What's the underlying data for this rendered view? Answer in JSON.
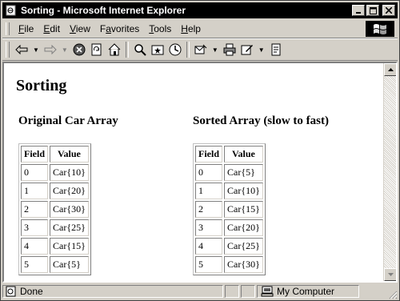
{
  "window": {
    "title": "Sorting - Microsoft Internet Explorer"
  },
  "menu": {
    "items": [
      {
        "key": "F",
        "rest": "ile"
      },
      {
        "key": "E",
        "rest": "dit"
      },
      {
        "key": "V",
        "rest": "iew"
      },
      {
        "key": "",
        "pre": "F",
        "key2": "a",
        "rest": "vorites"
      },
      {
        "key": "T",
        "rest": "ools"
      },
      {
        "key": "H",
        "rest": "elp"
      }
    ]
  },
  "toolbar": {
    "icons": [
      "back-icon",
      "forward-icon",
      "stop-icon",
      "refresh-icon",
      "home-icon",
      "search-icon",
      "favorites-icon",
      "history-icon",
      "mail-icon",
      "print-icon",
      "edit-icon",
      "discuss-icon"
    ]
  },
  "page": {
    "title": "Sorting",
    "original": {
      "heading": "Original Car Array",
      "col_field": "Field",
      "col_value": "Value",
      "rows": [
        {
          "field": "0",
          "value": "Car{10}"
        },
        {
          "field": "1",
          "value": "Car{20}"
        },
        {
          "field": "2",
          "value": "Car{30}"
        },
        {
          "field": "3",
          "value": "Car{25}"
        },
        {
          "field": "4",
          "value": "Car{15}"
        },
        {
          "field": "5",
          "value": "Car{5}"
        }
      ]
    },
    "sorted": {
      "heading": "Sorted Array (slow to fast)",
      "col_field": "Field",
      "col_value": "Value",
      "rows": [
        {
          "field": "0",
          "value": "Car{5}"
        },
        {
          "field": "1",
          "value": "Car{10}"
        },
        {
          "field": "2",
          "value": "Car{15}"
        },
        {
          "field": "3",
          "value": "Car{20}"
        },
        {
          "field": "4",
          "value": "Car{25}"
        },
        {
          "field": "5",
          "value": "Car{30}"
        }
      ]
    }
  },
  "status": {
    "text": "Done",
    "zone": "My Computer"
  }
}
